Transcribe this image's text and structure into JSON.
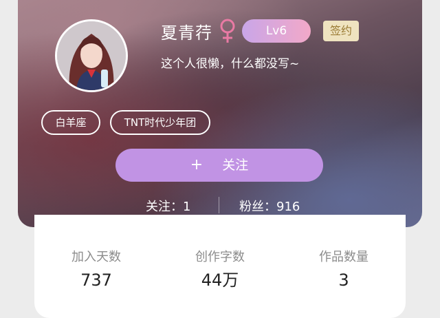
{
  "profile": {
    "name": "夏青荇",
    "level": "Lv6",
    "sign_badge": "签约",
    "bio": "这个人很懒，什么都没写~",
    "tags": [
      "白羊座",
      "TNT时代少年团"
    ],
    "follow_button": {
      "icon": "+",
      "label": "关注"
    },
    "following": "关注：1",
    "fans": "粉丝：916"
  },
  "stats": [
    {
      "label": "加入天数",
      "value": "737"
    },
    {
      "label": "创作字数",
      "value": "44万"
    },
    {
      "label": "作品数量",
      "value": "3"
    }
  ],
  "colors": {
    "top_bar": "#20a8e8",
    "follow_button": "#c193e4",
    "female_icon": "#e97aa4",
    "sign_badge_bg": "#efe3c0",
    "sign_badge_text": "#9a7b34"
  },
  "icons": {
    "gender": "female-icon",
    "follow": "plus-icon"
  }
}
